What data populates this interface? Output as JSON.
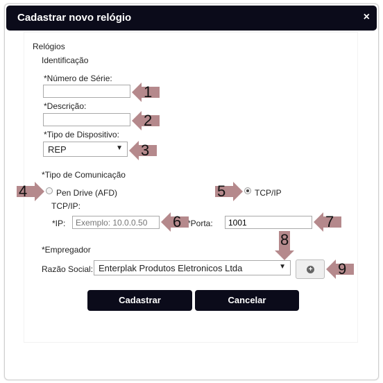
{
  "dialog": {
    "title": "Cadastrar novo relógio",
    "close_icon": "×"
  },
  "section": {
    "title": "Relógios",
    "subtitle": "Identificação"
  },
  "fields": {
    "serial_label": "*Número de Série:",
    "serial_value": "",
    "description_label": "*Descrição:",
    "description_value": "",
    "device_type_label": "*Tipo de Dispositivo:",
    "device_type_value": "REP",
    "comm_type_label": "*Tipo de Comunicação",
    "radio_pendrive_label": "Pen Drive (AFD)",
    "radio_tcpip_label": "TCP/IP",
    "tcpip_section_label": "TCP/IP:",
    "ip_label": "*IP:",
    "ip_placeholder": "Exemplo: 10.0.0.50",
    "port_label": "*Porta:",
    "port_value": "1001",
    "employer_label": "*Empregador",
    "company_label": "Razão Social:",
    "company_value": "Enterplak Produtos Eletronicos Ltda"
  },
  "buttons": {
    "submit": "Cadastrar",
    "cancel": "Cancelar"
  },
  "annotations": [
    "1",
    "2",
    "3",
    "4",
    "5",
    "6",
    "7",
    "8",
    "9"
  ],
  "colors": {
    "header_bg": "#0b0b1a",
    "annotation_arrow": "#b5898c"
  }
}
